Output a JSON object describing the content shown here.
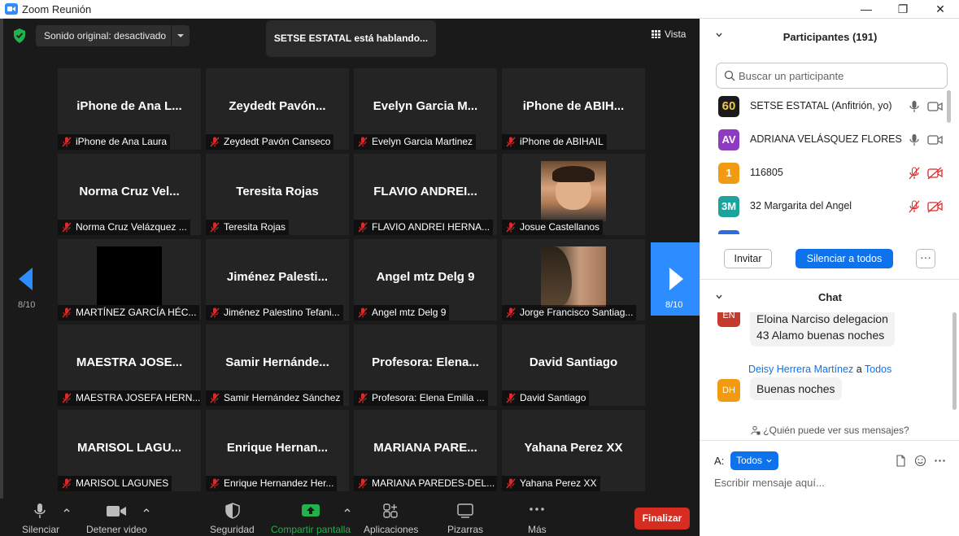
{
  "window": {
    "title": "Zoom Reunión",
    "minimize": "—",
    "maximize": "❐",
    "close": "✕"
  },
  "meeting_top": {
    "sound_button": "Sonido original: desactivado",
    "speaking_banner": "SETSE ESTATAL está hablando...",
    "view_button": "Vista"
  },
  "gallery": {
    "tiles": [
      {
        "big": "iPhone de Ana L...",
        "label": "iPhone de Ana Laura"
      },
      {
        "big": "Zeydedt Pavón...",
        "label": "Zeydedt Pavón Canseco"
      },
      {
        "big": "Evelyn Garcia M...",
        "label": "Evelyn Garcia Martinez"
      },
      {
        "big": "iPhone de ABIH...",
        "label": "iPhone de ABIHAIL"
      },
      {
        "big": "Norma Cruz Vel...",
        "label": "Norma Cruz Velázquez ..."
      },
      {
        "big": "Teresita Rojas",
        "label": "Teresita Rojas"
      },
      {
        "big": "FLAVIO ANDREI...",
        "label": "FLAVIO ANDREI HERNA..."
      },
      {
        "big": "",
        "label": "Josue Castellanos"
      },
      {
        "big": "",
        "label": "MARTÍNEZ GARCÍA HÉC..."
      },
      {
        "big": "Jiménez Palesti...",
        "label": "Jiménez Palestino Tefani..."
      },
      {
        "big": "Angel mtz Delg 9",
        "label": "Angel mtz Delg 9"
      },
      {
        "big": "",
        "label": "Jorge Francisco Santiag..."
      },
      {
        "big": "MAESTRA JOSE...",
        "label": "MAESTRA JOSEFA HERN..."
      },
      {
        "big": "Samir Hernánde...",
        "label": "Samir Hernández Sánchez"
      },
      {
        "big": "Profesora: Elena...",
        "label": "Profesora: Elena Emilia ..."
      },
      {
        "big": "David Santiago",
        "label": "David Santiago"
      },
      {
        "big": "MARISOL LAGU...",
        "label": "MARISOL LAGUNES"
      },
      {
        "big": "Enrique Hernan...",
        "label": "Enrique Hernandez Her..."
      },
      {
        "big": "MARIANA PARE...",
        "label": "MARIANA PAREDES-DEL..."
      },
      {
        "big": "Yahana Perez XX",
        "label": "Yahana Perez XX"
      }
    ],
    "page_left": "8/10",
    "page_right": "8/10"
  },
  "toolbar": {
    "mute": "Silenciar",
    "stop_video": "Detener video",
    "security": "Seguridad",
    "share_screen": "Compartir pantalla",
    "apps": "Aplicaciones",
    "whiteboards": "Pizarras",
    "more": "Más",
    "end": "Finalizar"
  },
  "participants": {
    "title": "Participantes (191)",
    "search_placeholder": "Buscar un participante",
    "list": [
      {
        "avatar": "60",
        "name": "SETSE ESTATAL (Anfitrión, yo)",
        "color": "#1a1a1a"
      },
      {
        "avatar": "AV",
        "name": "ADRIANA VELÁSQUEZ FLORES",
        "color": "#8f3bbf"
      },
      {
        "avatar": "1",
        "name": "116805",
        "color": "#f29a11"
      },
      {
        "avatar": "3M",
        "name": "32 Margarita del Angel",
        "color": "#1ca39b"
      }
    ],
    "invite": "Invitar",
    "mute_all": "Silenciar a todos",
    "more": "···"
  },
  "chat": {
    "title": "Chat",
    "messages": [
      {
        "avatar": "EN",
        "text_line1": "Eloina Narciso delegacion",
        "text_line2": "43 Alamo buenas noches",
        "color": "#c23b2c"
      },
      {
        "avatar": "DH",
        "sender": "Deisy Herrera Martínez",
        "to_word": "a",
        "to": "Todos",
        "text": "Buenas noches",
        "color": "#f29a11"
      }
    ],
    "who_can_see": "¿Quién puede ver sus mensajes?",
    "to_label": "A:",
    "to_value": "Todos",
    "input_placeholder": "Escribir mensaje aquí..."
  }
}
